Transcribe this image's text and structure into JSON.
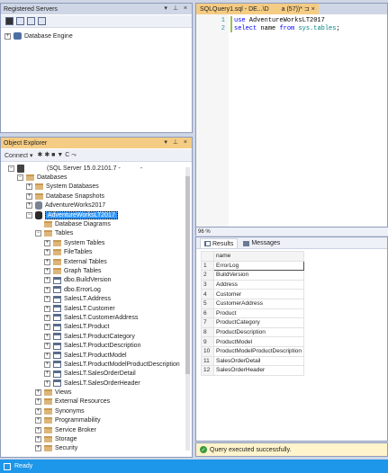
{
  "registered_servers": {
    "title": "Registered Servers",
    "pin_label": "▾ ⊥ ×",
    "tree": [
      {
        "label": "Database Engine"
      }
    ]
  },
  "object_explorer": {
    "title": "Object Explorer",
    "pin_label": "▾ ⊥ ×",
    "connect_label": "Connect ▾",
    "toolbar_glyphs": "✱  ✱  ■  ▼  C  ⤳",
    "server_label": "(SQL Server 15.0.2101.7 -",
    "server_suffix": "-",
    "tree": {
      "databases": "Databases",
      "system_databases": "System Databases",
      "database_snapshots": "Database Snapshots",
      "adventureworks2017": "AdventureWorks2017",
      "adventureworkslt2017": "AdventureWorksLT2017",
      "database_diagrams": "Database Diagrams",
      "tables": "Tables",
      "system_tables": "System Tables",
      "filetables": "FileTables",
      "external_tables": "External Tables",
      "graph_tables": "Graph Tables",
      "table_items": [
        "dbo.BuildVersion",
        "dbo.ErrorLog",
        "SalesLT.Address",
        "SalesLT.Customer",
        "SalesLT.CustomerAddress",
        "SalesLT.Product",
        "SalesLT.ProductCategory",
        "SalesLT.ProductDescription",
        "SalesLT.ProductModel",
        "SalesLT.ProductModelProductDescription",
        "SalesLT.SalesOrderDetail",
        "SalesLT.SalesOrderHeader"
      ],
      "views": "Views",
      "external_resources": "External Resources",
      "synonyms": "Synonyms",
      "programmability": "Programmability",
      "service_broker": "Service Broker",
      "storage": "Storage",
      "security": "Security"
    }
  },
  "editor": {
    "tab_label": "SQLQuery1.sql - DE...\\D",
    "tab_suffix": "a (57))* ⊐ ×",
    "lines": [
      {
        "num": "1",
        "kw": "use",
        "rest": " AdventureWorksLT2017"
      },
      {
        "num": "2",
        "kw": "select",
        "rest_kw": " name ",
        "kw2": "from",
        "obj": " sys.tables",
        "end": ";"
      }
    ]
  },
  "zoom": "96 %",
  "results": {
    "tab_results": "Results",
    "tab_messages": "Messages",
    "column": "name",
    "rows": [
      {
        "idx": "1",
        "name": "ErrorLog"
      },
      {
        "idx": "2",
        "name": "BuildVersion"
      },
      {
        "idx": "3",
        "name": "Address"
      },
      {
        "idx": "4",
        "name": "Customer"
      },
      {
        "idx": "5",
        "name": "CustomerAddress"
      },
      {
        "idx": "6",
        "name": "Product"
      },
      {
        "idx": "7",
        "name": "ProductCategory"
      },
      {
        "idx": "8",
        "name": "ProductDescription"
      },
      {
        "idx": "9",
        "name": "ProductModel"
      },
      {
        "idx": "10",
        "name": "ProductModelProductDescription"
      },
      {
        "idx": "11",
        "name": "SalesOrderDetail"
      },
      {
        "idx": "12",
        "name": "SalesOrderHeader"
      }
    ]
  },
  "query_status": "Query executed successfully.",
  "status_bar": "Ready"
}
